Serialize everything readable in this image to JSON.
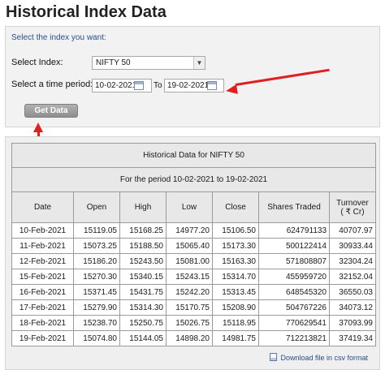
{
  "page_title": "Historical Index Data",
  "form": {
    "prompt": "Select the index you want:",
    "index_label": "Select Index:",
    "index_value": "NIFTY 50",
    "period_label": "Select a time period:",
    "from_date": "10-02-2021",
    "to_label": "To",
    "to_date": "19-02-2021",
    "button_label": "Get Data"
  },
  "table": {
    "caption": "Historical Data for NIFTY 50",
    "period": "For the period 10-02-2021 to 19-02-2021",
    "columns": [
      "Date",
      "Open",
      "High",
      "Low",
      "Close",
      "Shares Traded",
      "Turnover\n( ₹ Cr)"
    ],
    "rows": [
      [
        "10-Feb-2021",
        "15119.05",
        "15168.25",
        "14977.20",
        "15106.50",
        "624791133",
        "40707.97"
      ],
      [
        "11-Feb-2021",
        "15073.25",
        "15188.50",
        "15065.40",
        "15173.30",
        "500122414",
        "30933.44"
      ],
      [
        "12-Feb-2021",
        "15186.20",
        "15243.50",
        "15081.00",
        "15163.30",
        "571808807",
        "32304.24"
      ],
      [
        "15-Feb-2021",
        "15270.30",
        "15340.15",
        "15243.15",
        "15314.70",
        "455959720",
        "32152.04"
      ],
      [
        "16-Feb-2021",
        "15371.45",
        "15431.75",
        "15242.20",
        "15313.45",
        "648545320",
        "36550.03"
      ],
      [
        "17-Feb-2021",
        "15279.90",
        "15314.30",
        "15170.75",
        "15208.90",
        "504767226",
        "34073.12"
      ],
      [
        "18-Feb-2021",
        "15238.70",
        "15250.75",
        "15026.75",
        "15118.95",
        "770629541",
        "37093.99"
      ],
      [
        "19-Feb-2021",
        "15074.80",
        "15144.05",
        "14898.20",
        "14981.75",
        "712213821",
        "37419.34"
      ]
    ],
    "download_label": "Download file in csv format"
  },
  "colors": {
    "annotation_arrow": "#e02020",
    "link": "#2a4d8a"
  }
}
